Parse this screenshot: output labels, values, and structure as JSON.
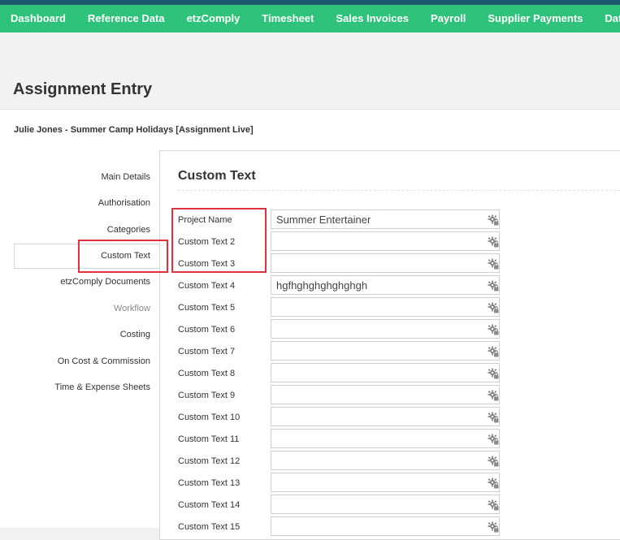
{
  "nav": {
    "items": [
      "Dashboard",
      "Reference Data",
      "etzComply",
      "Timesheet",
      "Sales Invoices",
      "Payroll",
      "Supplier Payments",
      "Data Ex"
    ]
  },
  "page": {
    "title": "Assignment Entry",
    "assignment_title": "Julie Jones - Summer Camp Holidays [Assignment Live]"
  },
  "sidebar": {
    "items": [
      {
        "label": "Main Details",
        "state": "normal"
      },
      {
        "label": "Authorisation",
        "state": "normal"
      },
      {
        "label": "Categories",
        "state": "normal"
      },
      {
        "label": "Custom Text",
        "state": "active"
      },
      {
        "label": "etzComply Documents",
        "state": "normal"
      },
      {
        "label": "Workflow",
        "state": "disabled"
      },
      {
        "label": "Costing",
        "state": "normal"
      },
      {
        "label": "On Cost & Commission",
        "state": "normal"
      },
      {
        "label": "Time & Expense Sheets",
        "state": "normal"
      }
    ]
  },
  "panel": {
    "title": "Custom Text",
    "fields": [
      {
        "label": "Project Name",
        "value": "Summer Entertainer"
      },
      {
        "label": "Custom Text 2",
        "value": ""
      },
      {
        "label": "Custom Text 3",
        "value": ""
      },
      {
        "label": "Custom Text 4",
        "value": "hgfhghghghghghgh"
      },
      {
        "label": "Custom Text 5",
        "value": ""
      },
      {
        "label": "Custom Text 6",
        "value": ""
      },
      {
        "label": "Custom Text 7",
        "value": ""
      },
      {
        "label": "Custom Text 8",
        "value": ""
      },
      {
        "label": "Custom Text 9",
        "value": ""
      },
      {
        "label": "Custom Text 10",
        "value": ""
      },
      {
        "label": "Custom Text 11",
        "value": ""
      },
      {
        "label": "Custom Text 12",
        "value": ""
      },
      {
        "label": "Custom Text 13",
        "value": ""
      },
      {
        "label": "Custom Text 14",
        "value": ""
      },
      {
        "label": "Custom Text 15",
        "value": ""
      }
    ]
  },
  "colors": {
    "nav_bg": "#2fc27b",
    "top_strip": "#1d5a70",
    "highlight": "#e0323c"
  },
  "icons": {
    "field_action": "gear-lock-icon"
  }
}
